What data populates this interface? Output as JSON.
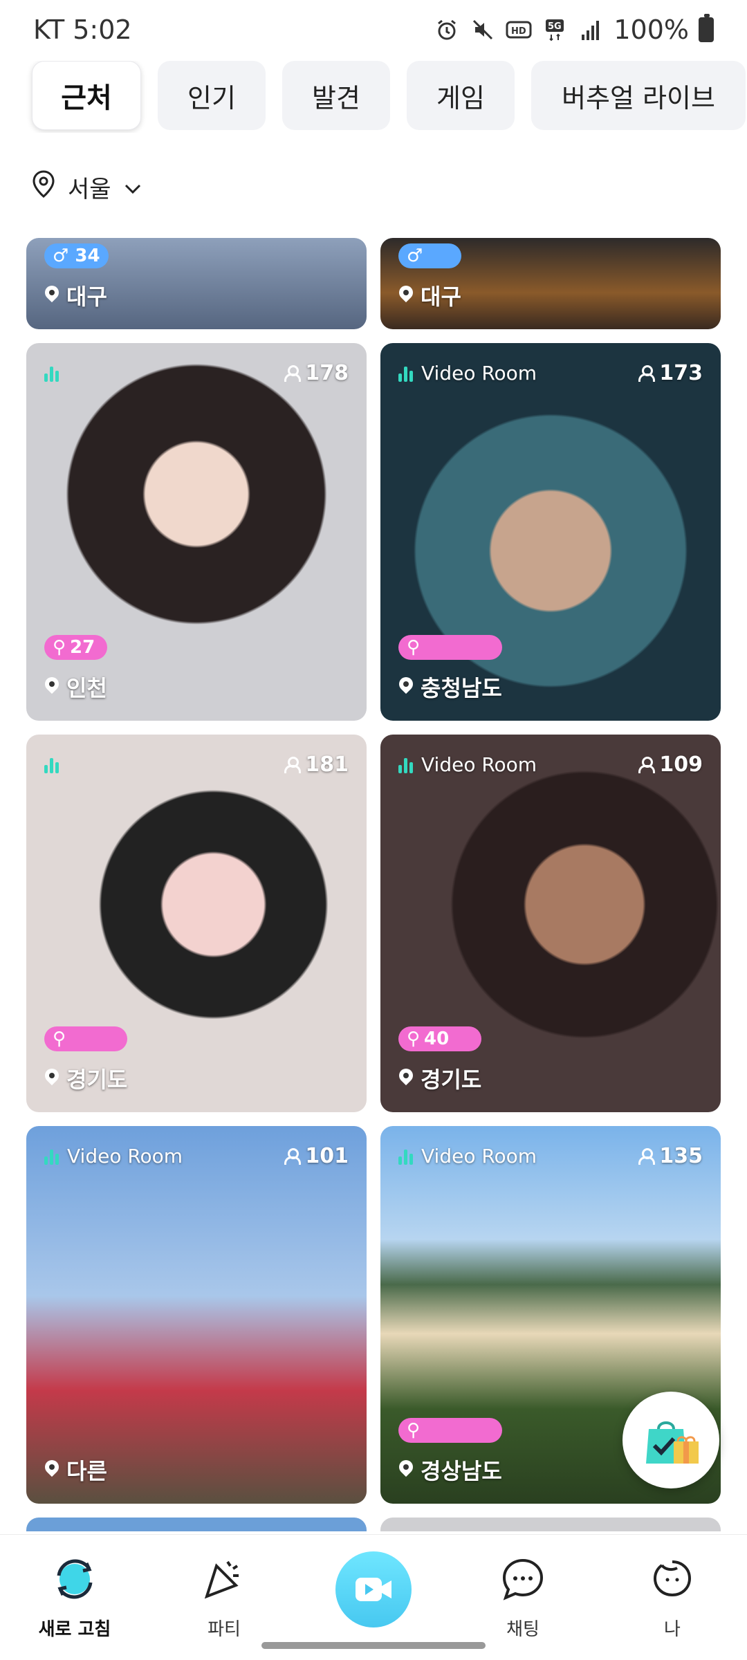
{
  "status_bar": {
    "carrier_time": "KT 5:02",
    "battery": "100%"
  },
  "tabs": [
    {
      "label": "근처",
      "active": true
    },
    {
      "label": "인기",
      "active": false
    },
    {
      "label": "발견",
      "active": false
    },
    {
      "label": "게임",
      "active": false
    },
    {
      "label": "버추얼 라이브",
      "active": false
    }
  ],
  "location_filter": {
    "label": "서울"
  },
  "cards": [
    {
      "badge": "♂ 34",
      "badge_type": "blue",
      "location": "대구"
    },
    {
      "badge": "♂",
      "badge_type": "blue",
      "location": "대구"
    },
    {
      "room": "",
      "viewers": "178",
      "badge": "27",
      "badge_type": "pink",
      "location": "인천"
    },
    {
      "room": "Video Room",
      "viewers": "173",
      "badge": "",
      "badge_type": "pink",
      "location": "충청남도"
    },
    {
      "room": "",
      "viewers": "181",
      "badge": "",
      "badge_type": "pink",
      "location": "경기도"
    },
    {
      "room": "Video Room",
      "viewers": "109",
      "badge": "40",
      "badge_type": "pink",
      "location": "경기도"
    },
    {
      "room": "Video Room",
      "viewers": "101",
      "badge": "",
      "badge_type": "none",
      "location": "다른"
    },
    {
      "room": "Video Room",
      "viewers": "135",
      "badge": "",
      "badge_type": "pink",
      "location": "경상남도"
    }
  ],
  "bottom_nav": [
    {
      "label": "새로 고침",
      "icon": "refresh-icon",
      "active": true
    },
    {
      "label": "파티",
      "icon": "party-icon",
      "active": false
    },
    {
      "label": "",
      "icon": "video-icon",
      "active": false
    },
    {
      "label": "채팅",
      "icon": "chat-icon",
      "active": false
    },
    {
      "label": "나",
      "icon": "profile-icon",
      "active": false
    }
  ],
  "colors": {
    "accent": "#47c8f0",
    "live": "#33d9c0",
    "pink_badge": "#f26bd0"
  }
}
